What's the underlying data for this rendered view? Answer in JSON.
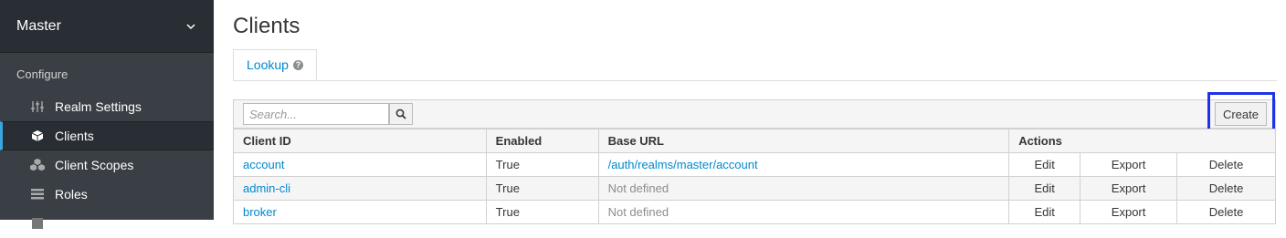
{
  "sidebar": {
    "realm_name": "Master",
    "section_title": "Configure",
    "items": [
      {
        "label": "Realm Settings",
        "icon": "sliders-icon"
      },
      {
        "label": "Clients",
        "icon": "cube-icon"
      },
      {
        "label": "Client Scopes",
        "icon": "cubes-icon"
      },
      {
        "label": "Roles",
        "icon": "list-icon"
      }
    ]
  },
  "page": {
    "title": "Clients",
    "tab_label": "Lookup",
    "help_glyph": "?"
  },
  "toolbar": {
    "search_placeholder": "Search...",
    "create_label": "Create"
  },
  "table": {
    "headers": [
      "Client ID",
      "Enabled",
      "Base URL",
      "Actions"
    ],
    "rows": [
      {
        "client_id": "account",
        "enabled": "True",
        "base_url": "/auth/realms/master/account",
        "edit": "Edit",
        "export": "Export",
        "delete": "Delete"
      },
      {
        "client_id": "admin-cli",
        "enabled": "True",
        "base_url": "Not defined",
        "edit": "Edit",
        "export": "Export",
        "delete": "Delete"
      },
      {
        "client_id": "broker",
        "enabled": "True",
        "base_url": "Not defined",
        "edit": "Edit",
        "export": "Export",
        "delete": "Delete"
      }
    ]
  },
  "colors": {
    "accent": "#0088ce",
    "sidebar_bg": "#393f44",
    "sidebar_active": "#292e34",
    "highlight": "#1d33e8"
  }
}
